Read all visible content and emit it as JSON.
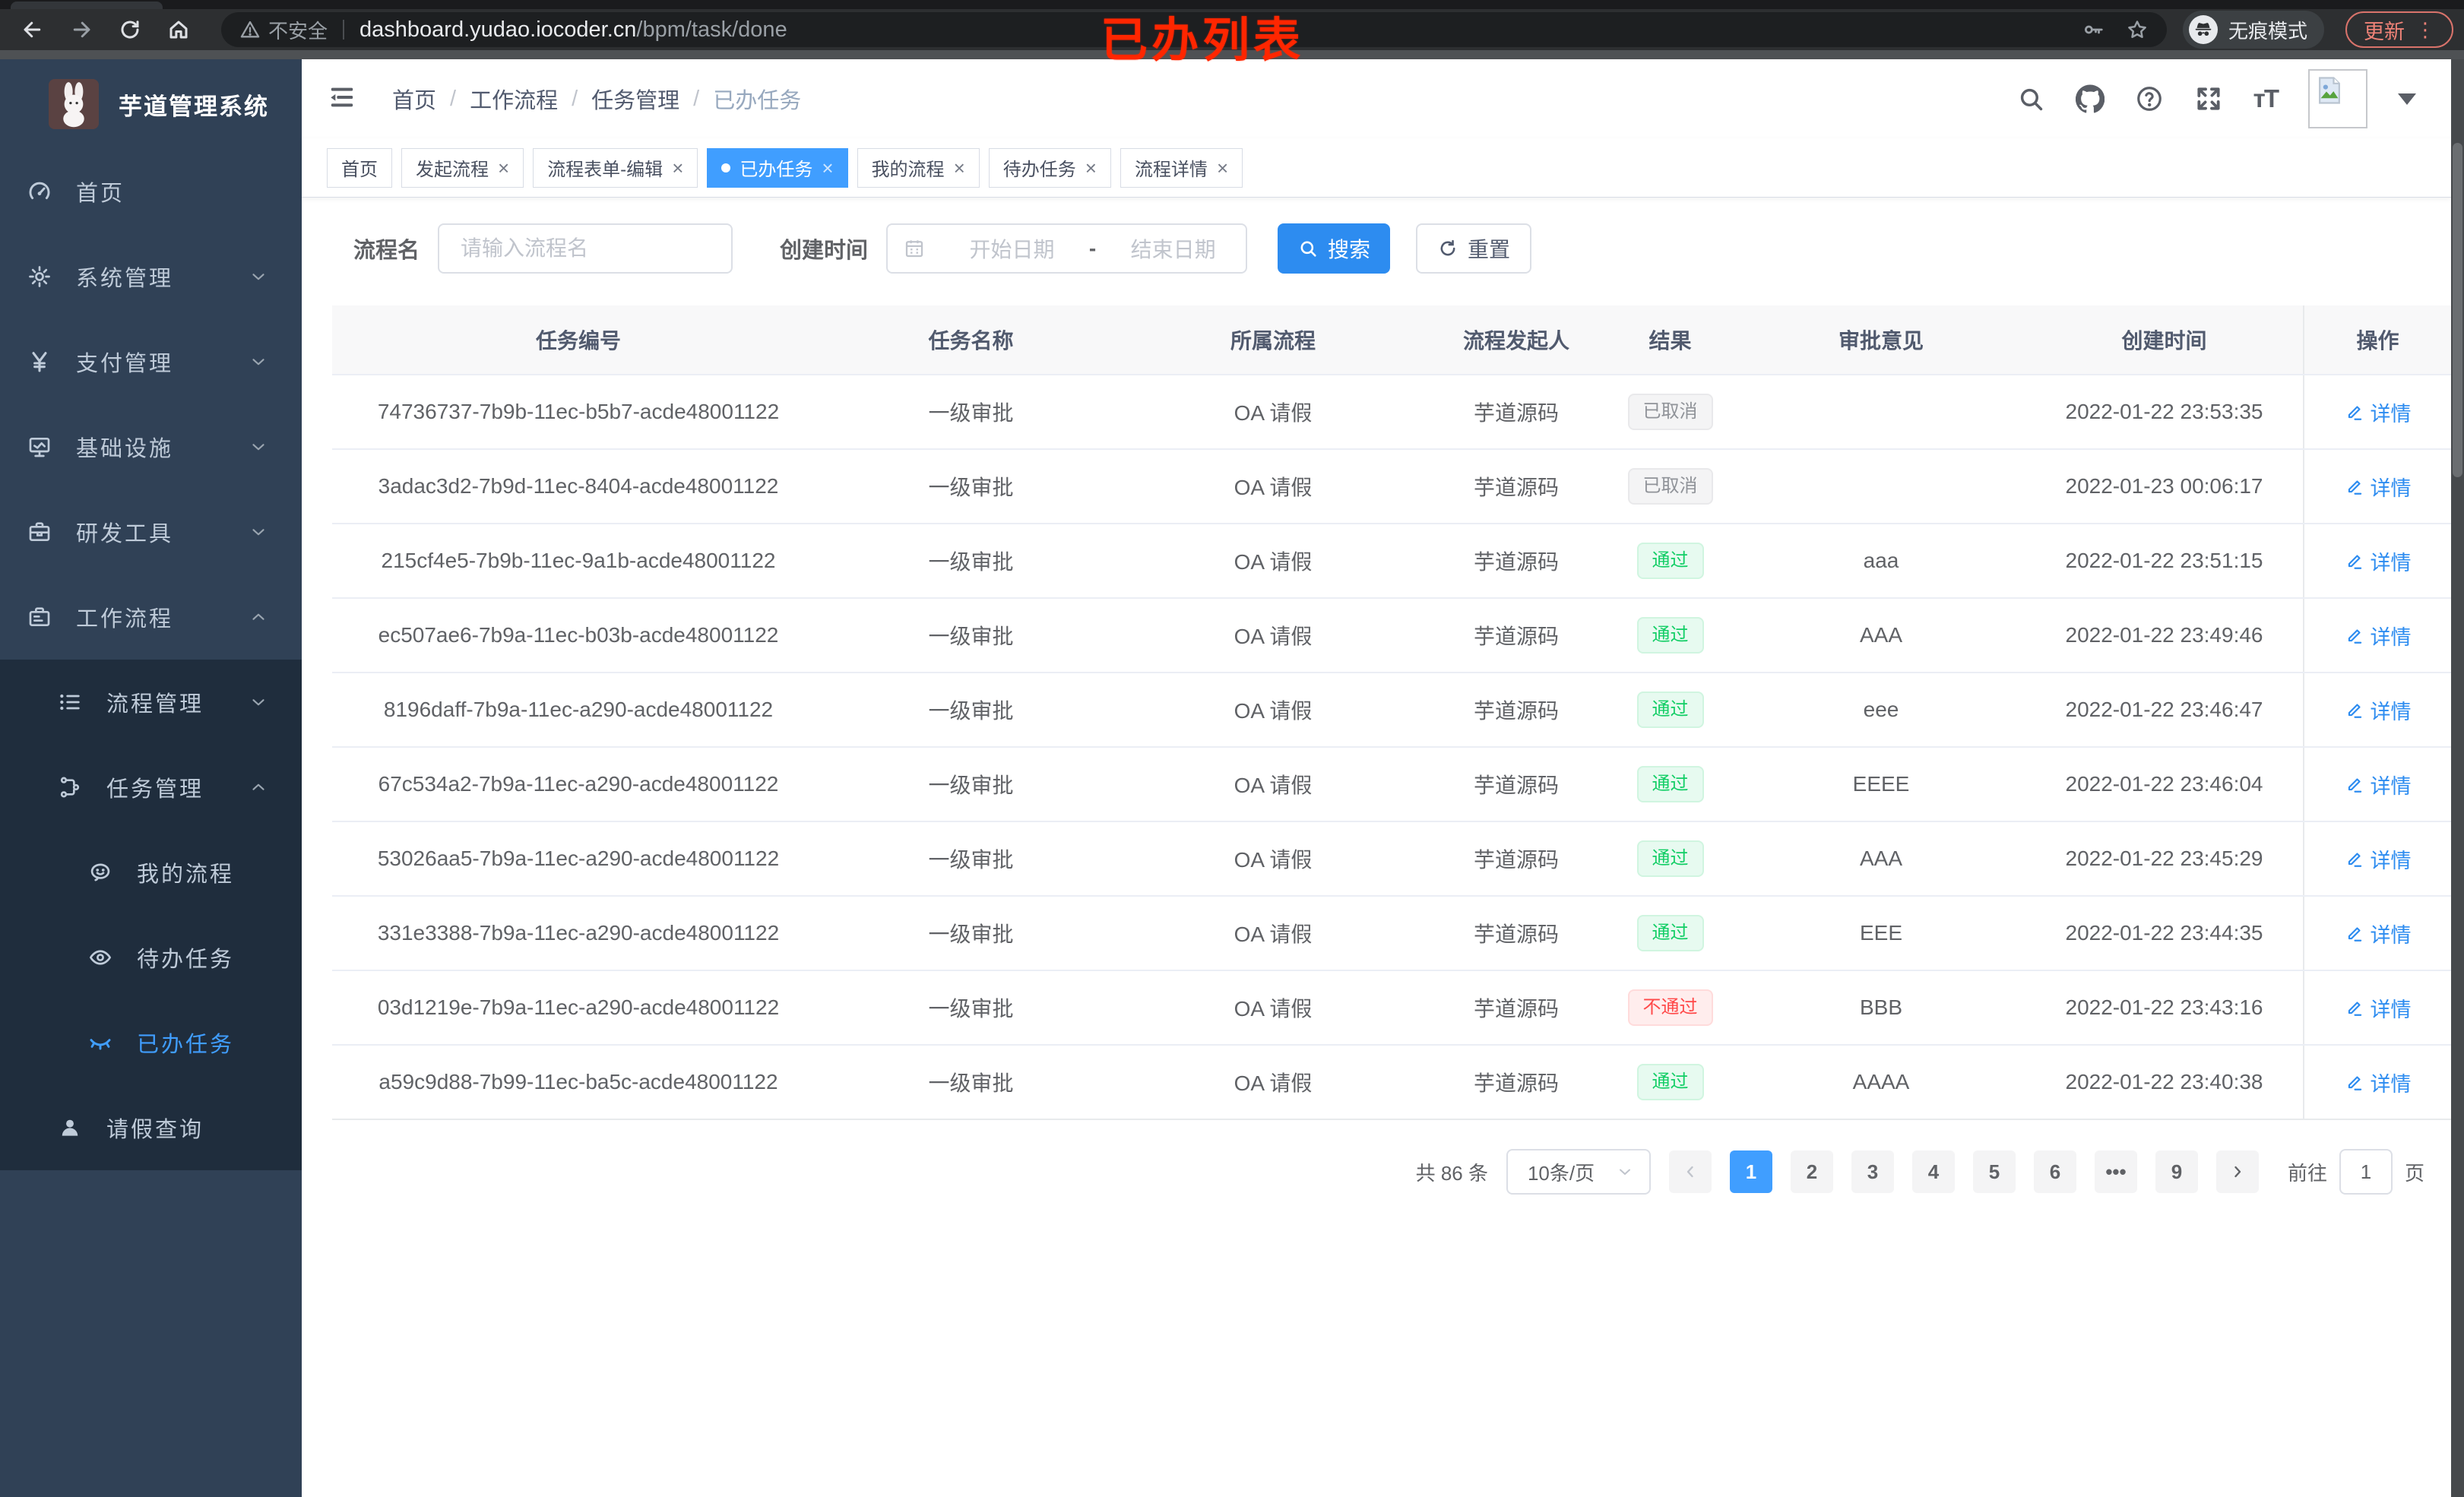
{
  "chrome": {
    "security": "不安全",
    "url_host": "dashboard.yudao.iocoder.cn",
    "url_path": "/bpm/task/done",
    "incognito_label": "无痕模式",
    "update_label": "更新",
    "menu_dots": "⋮"
  },
  "annotation": "已办列表",
  "sidebar": {
    "title": "芋道管理系统",
    "menu": [
      {
        "label": "首页",
        "icon": "dashboard-icon",
        "level": 1,
        "chevron": "",
        "sub": false,
        "active": false
      },
      {
        "label": "系统管理",
        "icon": "gear-icon",
        "level": 1,
        "chevron": "down",
        "sub": false,
        "active": false
      },
      {
        "label": "支付管理",
        "icon": "yen-icon",
        "level": 1,
        "chevron": "down",
        "sub": false,
        "active": false
      },
      {
        "label": "基础设施",
        "icon": "monitor-icon",
        "level": 1,
        "chevron": "down",
        "sub": false,
        "active": false
      },
      {
        "label": "研发工具",
        "icon": "toolbox-icon",
        "level": 1,
        "chevron": "down",
        "sub": false,
        "active": false
      },
      {
        "label": "工作流程",
        "icon": "briefcase-icon",
        "level": 1,
        "chevron": "up",
        "sub": false,
        "active": false
      },
      {
        "label": "流程管理",
        "icon": "list-icon",
        "level": 2,
        "chevron": "down",
        "sub": true,
        "active": false
      },
      {
        "label": "任务管理",
        "icon": "flow-icon",
        "level": 2,
        "chevron": "up",
        "sub": true,
        "active": false
      },
      {
        "label": "我的流程",
        "icon": "chat-icon",
        "level": 3,
        "chevron": "",
        "sub": true,
        "active": false
      },
      {
        "label": "待办任务",
        "icon": "eye-icon",
        "level": 3,
        "chevron": "",
        "sub": true,
        "active": false
      },
      {
        "label": "已办任务",
        "icon": "eye-closed-icon",
        "level": 3,
        "chevron": "",
        "sub": true,
        "active": true
      },
      {
        "label": "请假查询",
        "icon": "user-icon",
        "level": 2,
        "chevron": "",
        "sub": true,
        "active": false
      }
    ]
  },
  "navbar": {
    "breadcrumb": [
      "首页",
      "工作流程",
      "任务管理",
      "已办任务"
    ],
    "separator": "/"
  },
  "tabs": [
    {
      "label": "首页",
      "closable": false,
      "active": false
    },
    {
      "label": "发起流程",
      "closable": true,
      "active": false
    },
    {
      "label": "流程表单-编辑",
      "closable": true,
      "active": false
    },
    {
      "label": "已办任务",
      "closable": true,
      "active": true
    },
    {
      "label": "我的流程",
      "closable": true,
      "active": false
    },
    {
      "label": "待办任务",
      "closable": true,
      "active": false
    },
    {
      "label": "流程详情",
      "closable": true,
      "active": false
    }
  ],
  "filters": {
    "name_label": "流程名",
    "name_placeholder": "请输入流程名",
    "time_label": "创建时间",
    "start_placeholder": "开始日期",
    "range_separator": "-",
    "end_placeholder": "结束日期",
    "search_label": "搜索",
    "reset_label": "重置"
  },
  "table": {
    "headers": [
      "任务编号",
      "任务名称",
      "所属流程",
      "流程发起人",
      "结果",
      "审批意见",
      "创建时间",
      "操作"
    ],
    "action_label": "详情",
    "rows": [
      {
        "id": "74736737-7b9b-11ec-b5b7-acde48001122",
        "name": "一级审批",
        "process": "OA 请假",
        "starter": "芋道源码",
        "result": "已取消",
        "result_type": "info",
        "comment": "",
        "time": "2022-01-22 23:53:35"
      },
      {
        "id": "3adac3d2-7b9d-11ec-8404-acde48001122",
        "name": "一级审批",
        "process": "OA 请假",
        "starter": "芋道源码",
        "result": "已取消",
        "result_type": "info",
        "comment": "",
        "time": "2022-01-23 00:06:17"
      },
      {
        "id": "215cf4e5-7b9b-11ec-9a1b-acde48001122",
        "name": "一级审批",
        "process": "OA 请假",
        "starter": "芋道源码",
        "result": "通过",
        "result_type": "success",
        "comment": "aaa",
        "time": "2022-01-22 23:51:15"
      },
      {
        "id": "ec507ae6-7b9a-11ec-b03b-acde48001122",
        "name": "一级审批",
        "process": "OA 请假",
        "starter": "芋道源码",
        "result": "通过",
        "result_type": "success",
        "comment": "AAA",
        "time": "2022-01-22 23:49:46"
      },
      {
        "id": "8196daff-7b9a-11ec-a290-acde48001122",
        "name": "一级审批",
        "process": "OA 请假",
        "starter": "芋道源码",
        "result": "通过",
        "result_type": "success",
        "comment": "eee",
        "time": "2022-01-22 23:46:47"
      },
      {
        "id": "67c534a2-7b9a-11ec-a290-acde48001122",
        "name": "一级审批",
        "process": "OA 请假",
        "starter": "芋道源码",
        "result": "通过",
        "result_type": "success",
        "comment": "EEEE",
        "time": "2022-01-22 23:46:04"
      },
      {
        "id": "53026aa5-7b9a-11ec-a290-acde48001122",
        "name": "一级审批",
        "process": "OA 请假",
        "starter": "芋道源码",
        "result": "通过",
        "result_type": "success",
        "comment": "AAA",
        "time": "2022-01-22 23:45:29"
      },
      {
        "id": "331e3388-7b9a-11ec-a290-acde48001122",
        "name": "一级审批",
        "process": "OA 请假",
        "starter": "芋道源码",
        "result": "通过",
        "result_type": "success",
        "comment": "EEE",
        "time": "2022-01-22 23:44:35"
      },
      {
        "id": "03d1219e-7b9a-11ec-a290-acde48001122",
        "name": "一级审批",
        "process": "OA 请假",
        "starter": "芋道源码",
        "result": "不通过",
        "result_type": "danger",
        "comment": "BBB",
        "time": "2022-01-22 23:43:16"
      },
      {
        "id": "a59c9d88-7b99-11ec-ba5c-acde48001122",
        "name": "一级审批",
        "process": "OA 请假",
        "starter": "芋道源码",
        "result": "通过",
        "result_type": "success",
        "comment": "AAAA",
        "time": "2022-01-22 23:40:38"
      }
    ]
  },
  "pagination": {
    "total": "共 86 条",
    "page_size": "10条/页",
    "pages": [
      "1",
      "2",
      "3",
      "4",
      "5",
      "6",
      "•••",
      "9"
    ],
    "active_page": "1",
    "goto_label": "前往",
    "goto_value": "1",
    "goto_suffix": "页"
  },
  "colors": {
    "accent": "#409eff",
    "primary_button": "#2d8cf0",
    "success": "#13ce66",
    "danger": "#ff4949",
    "info": "#909399",
    "sidebar_bg": "#304156",
    "submenu_bg": "#1f2d3d"
  }
}
